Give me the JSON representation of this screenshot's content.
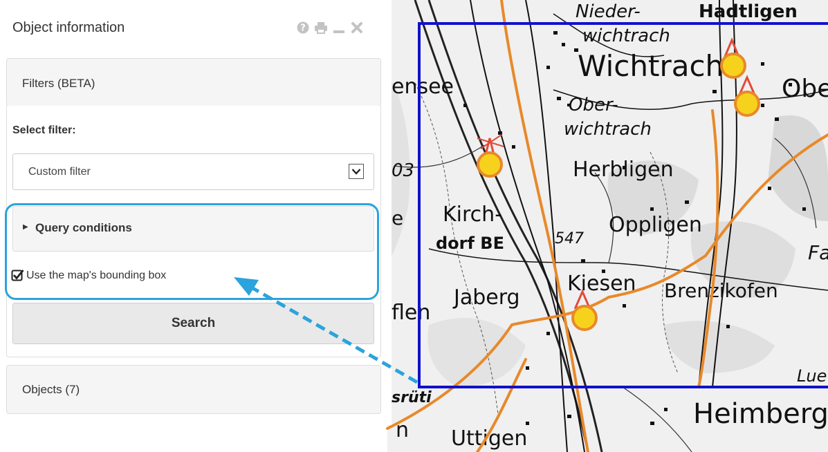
{
  "panel": {
    "title": "Object information",
    "header_icons": [
      "help-icon",
      "print-icon",
      "minimize-icon",
      "close-icon"
    ]
  },
  "filters": {
    "title": "Filters (BETA)",
    "select_label": "Select filter:",
    "selected_filter": "Custom filter",
    "query_conditions_label": "Query conditions",
    "bounding_box_label": "Use the map's bounding box",
    "bounding_box_checked": true,
    "search_button": "Search"
  },
  "objects": {
    "title": "Objects (7)"
  },
  "map": {
    "labels": {
      "wichtrach_big": "Wichtrach",
      "niederwichtrach_a": "Nieder-",
      "niederwichtrach_b": "wichtrach",
      "hadtligen": "Hadtligen",
      "ober_a": "Ober-",
      "ober_b": "wichtrach",
      "ober_right": "Obe",
      "herbligen": "Herbligen",
      "kirch_a": "Kirch-",
      "kirch_b": "dorf BE",
      "oppligen": "Oppligen",
      "elev": "547",
      "kiesen": "Kiesen",
      "brenzikofen": "Brenzikofen",
      "jaberg": "Jaberg",
      "flen": "flen",
      "ensee": "ensee",
      "heimberg": "Heimberg",
      "uttigen": "Uttigen",
      "n": "n",
      "srüti": "srüti",
      "lue": "Lue",
      "fa": "Fa",
      "num03": "03",
      "e_char": "e"
    },
    "colors": {
      "bounding_box": "#1111cc",
      "route": "#e8892a",
      "marker_fill": "#f7d21d",
      "marker_outline": "#e8892a",
      "marker_tip": "#e24a3a",
      "annotation": "#2ba3dc"
    }
  }
}
